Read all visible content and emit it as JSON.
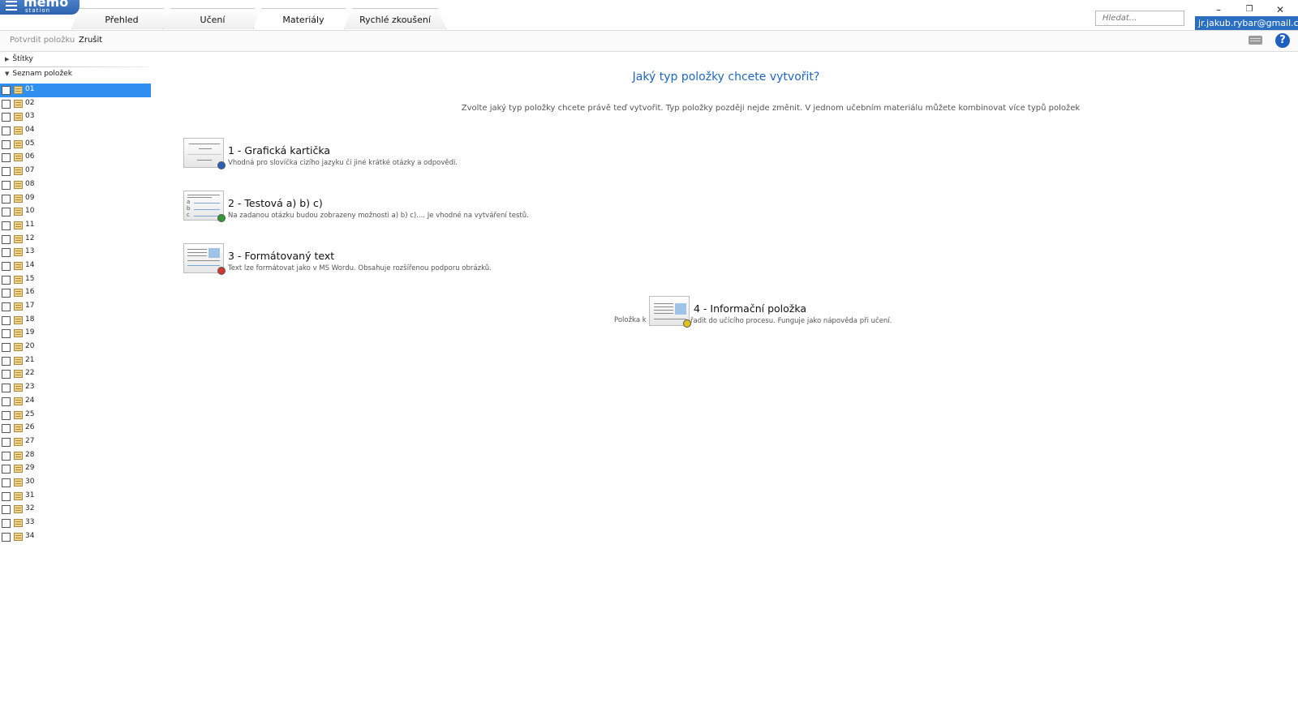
{
  "app": {
    "logo_text": "memo",
    "logo_subtext": "station"
  },
  "tabs": [
    {
      "label": "Přehled"
    },
    {
      "label": "Učení"
    },
    {
      "label": "Materiály"
    },
    {
      "label": "Rychlé zkoušení"
    }
  ],
  "search": {
    "placeholder": "Hledat..."
  },
  "window": {
    "minimize": "–",
    "restore": "❐",
    "close": "✕"
  },
  "account": {
    "email": "jr.jakub.rybar@gmail.com"
  },
  "toolbar": {
    "confirm_label": "Potvrdit položku",
    "cancel_label": "Zrušit",
    "help_label": "?"
  },
  "sidebar": {
    "tags_label": "Štítky",
    "items_label": "Seznam položek",
    "items": [
      "01",
      "02",
      "03",
      "04",
      "05",
      "06",
      "07",
      "08",
      "09",
      "10",
      "11",
      "12",
      "13",
      "14",
      "15",
      "16",
      "17",
      "18",
      "19",
      "20",
      "21",
      "22",
      "23",
      "24",
      "25",
      "26",
      "27",
      "28",
      "29",
      "30",
      "31",
      "32",
      "33",
      "34"
    ],
    "selected_index": 0
  },
  "main": {
    "title": "Jaký typ položky chcete vytvořit?",
    "subtitle": "Zvolte jaký typ položky chcete právě teď vytvořit. Typ položky později nejde změnit. V jednom učebním materiálu můžete kombinovat více typů položek",
    "options": [
      {
        "title": "1 - Grafická kartička",
        "desc": "Vhodná pro slovíčka cizího jazyku či jiné krátké otázky a odpovědi.",
        "dot_color": "#2b5fb5"
      },
      {
        "title": "2 - Testová a) b) c)",
        "desc": "Na zadanou otázku budou zobrazeny možnosti a) b) c).... Je vhodné na vytváření testů.",
        "dot_color": "#2f9a2f"
      },
      {
        "title": "3 - Formátovaný text",
        "desc": "Text lze formátovat jako v MS Wordu. Obsahuje rozšířenou podporu obrázků.",
        "dot_color": "#d0392b"
      },
      {
        "title": "4 - Informační položka",
        "desc_left": "Položka k",
        "desc_right": "řadit do učícího procesu. Funguje jako nápověda při učení.",
        "dot_color": "#e2c21a"
      }
    ]
  }
}
